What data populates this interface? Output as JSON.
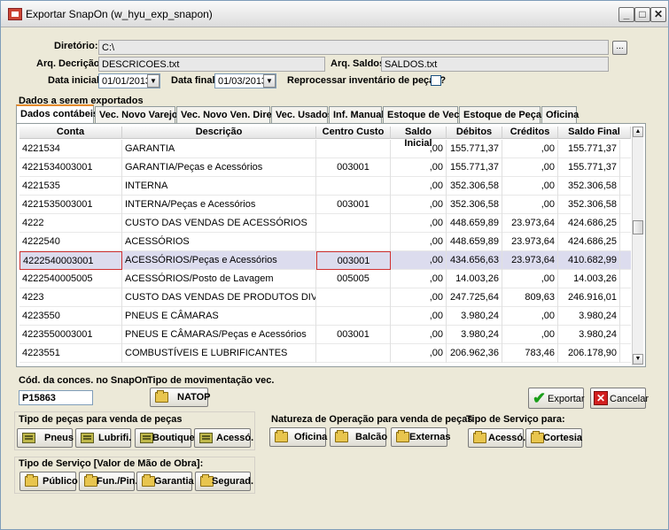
{
  "window": {
    "title": "Exportar SnapOn (w_hyu_exp_snapon)",
    "minimize": "_",
    "maximize": "□",
    "close": "✕"
  },
  "form": {
    "diretorio_label": "Diretório:",
    "diretorio_value": "C:\\",
    "browse_label": "...",
    "arq_descricao_label": "Arq. Decrição:",
    "arq_descricao_value": "DESCRICOES.txt",
    "arq_saldos_label": "Arq. Saldos:",
    "arq_saldos_value": "SALDOS.txt",
    "data_inicial_label": "Data inicial:",
    "data_inicial_value": "01/01/2013",
    "data_final_label": "Data final:",
    "data_final_value": "01/03/2013",
    "reprocessar_label": "Reprocessar inventário de peças?",
    "reprocessar_checked": false,
    "dados_label": "Dados a serem exportados"
  },
  "tabs": [
    {
      "label": "Dados contábeis",
      "active": true
    },
    {
      "label": "Vec. Novo Varejo",
      "active": false
    },
    {
      "label": "Vec. Novo Ven. Direta",
      "active": false
    },
    {
      "label": "Vec. Usados",
      "active": false
    },
    {
      "label": "Inf. Manual",
      "active": false
    },
    {
      "label": "Estoque de Vec.",
      "active": false
    },
    {
      "label": "Estoque de Peças",
      "active": false
    },
    {
      "label": "Oficina",
      "active": false
    }
  ],
  "grid": {
    "headers": [
      "Conta",
      "Descrição",
      "Centro Custo",
      "Saldo Inicial",
      "Débitos",
      "Créditos",
      "Saldo Final"
    ],
    "rows": [
      {
        "conta": "4221534",
        "descricao": "GARANTIA",
        "centro_custo": "",
        "saldo_inicial": ",00",
        "debitos": "155.771,37",
        "creditos": ",00",
        "saldo_final": "155.771,37"
      },
      {
        "conta": "4221534003001",
        "descricao": "GARANTIA/Peças e Acessórios",
        "centro_custo": "003001",
        "saldo_inicial": ",00",
        "debitos": "155.771,37",
        "creditos": ",00",
        "saldo_final": "155.771,37"
      },
      {
        "conta": "4221535",
        "descricao": "INTERNA",
        "centro_custo": "",
        "saldo_inicial": ",00",
        "debitos": "352.306,58",
        "creditos": ",00",
        "saldo_final": "352.306,58"
      },
      {
        "conta": "4221535003001",
        "descricao": "INTERNA/Peças e Acessórios",
        "centro_custo": "003001",
        "saldo_inicial": ",00",
        "debitos": "352.306,58",
        "creditos": ",00",
        "saldo_final": "352.306,58"
      },
      {
        "conta": "4222",
        "descricao": "CUSTO DAS VENDAS DE ACESSÓRIOS",
        "centro_custo": "",
        "saldo_inicial": ",00",
        "debitos": "448.659,89",
        "creditos": "23.973,64",
        "saldo_final": "424.686,25"
      },
      {
        "conta": "4222540",
        "descricao": "ACESSÓRIOS",
        "centro_custo": "",
        "saldo_inicial": ",00",
        "debitos": "448.659,89",
        "creditos": "23.973,64",
        "saldo_final": "424.686,25"
      },
      {
        "conta": "4222540003001",
        "descricao": "ACESSÓRIOS/Peças e Acessórios",
        "centro_custo": "003001",
        "saldo_inicial": ",00",
        "debitos": "434.656,63",
        "creditos": "23.973,64",
        "saldo_final": "410.682,99",
        "selected": true
      },
      {
        "conta": "4222540005005",
        "descricao": "ACESSÓRIOS/Posto de Lavagem",
        "centro_custo": "005005",
        "saldo_inicial": ",00",
        "debitos": "14.003,26",
        "creditos": ",00",
        "saldo_final": "14.003,26"
      },
      {
        "conta": "4223",
        "descricao": "CUSTO DAS VENDAS DE PRODUTOS DIVERSOS",
        "centro_custo": "",
        "saldo_inicial": ",00",
        "debitos": "247.725,64",
        "creditos": "809,63",
        "saldo_final": "246.916,01"
      },
      {
        "conta": "4223550",
        "descricao": "PNEUS E CÂMARAS",
        "centro_custo": "",
        "saldo_inicial": ",00",
        "debitos": "3.980,24",
        "creditos": ",00",
        "saldo_final": "3.980,24"
      },
      {
        "conta": "4223550003001",
        "descricao": "PNEUS E CÂMARAS/Peças e Acessórios",
        "centro_custo": "003001",
        "saldo_inicial": ",00",
        "debitos": "3.980,24",
        "creditos": ",00",
        "saldo_final": "3.980,24"
      },
      {
        "conta": "4223551",
        "descricao": "COMBUSTÍVEIS E LUBRIFICANTES",
        "centro_custo": "",
        "saldo_inicial": ",00",
        "debitos": "206.962,36",
        "creditos": "783,46",
        "saldo_final": "206.178,90"
      }
    ]
  },
  "bottom": {
    "cod_conces_label": "Cód. da conces. no SnapOn",
    "cod_conces_value": "P15863",
    "tipo_mov_label": "Tipo de movimentação vec.",
    "natop_label": "NATOP",
    "exportar_label": "Exportar",
    "cancelar_label": "Cancelar",
    "tipo_pecas_label": "Tipo de peças para venda de peças",
    "pecas_buttons": [
      "Pneus",
      "Lubrifi.",
      "Boutique",
      "Acessó."
    ],
    "natureza_label": "Natureza de Operação para venda de peças",
    "natureza_buttons": [
      "Oficina",
      "Balcão",
      "Externas"
    ],
    "tipo_servico_label": "Tipo de Serviço para:",
    "servico_buttons": [
      "Acessó.",
      "Cortesia"
    ],
    "tipo_servico_mo_label": "Tipo de Serviço [Valor de Mão de Obra]:",
    "mo_buttons": [
      "Público",
      "Fun./Pin.",
      "Garantia",
      "Segurad."
    ]
  },
  "colors": {
    "window_bg": "#ece9d8",
    "tab_active_accent": "#e68b2c",
    "selected_row": "#dcdcee",
    "outline_red": "#d03030",
    "check_green": "#1a9e1a",
    "cancel_red": "#d21f1f"
  }
}
